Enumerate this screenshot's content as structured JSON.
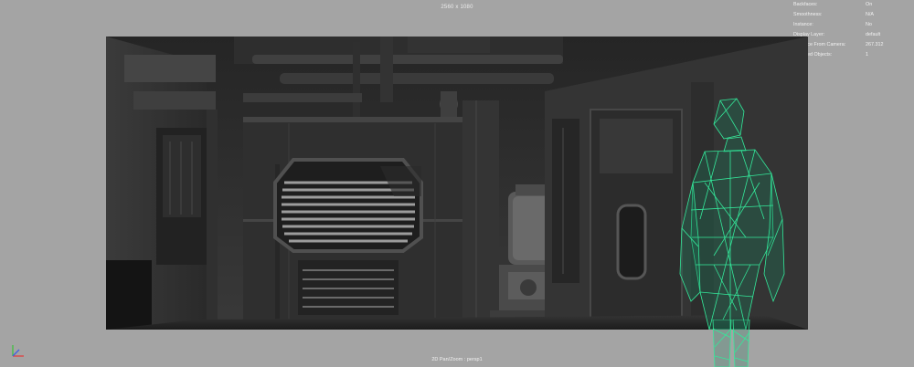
{
  "viewport": {
    "resolution_label": "2560 x 1080",
    "camera_label": "2D Pan/Zoom : persp1"
  },
  "hud": [
    {
      "key": "Backfaces:",
      "value": "On"
    },
    {
      "key": "Smoothness:",
      "value": "N/A"
    },
    {
      "key": "Instance:",
      "value": "No"
    },
    {
      "key": "Display Layer:",
      "value": "default"
    },
    {
      "key": "Distance From Camera:",
      "value": "267.312"
    },
    {
      "key": "Selected Objects:",
      "value": "1"
    }
  ],
  "scene": {
    "icons": [
      "axis-gizmo-icon"
    ],
    "colors": {
      "viewport_bg": "#a4a4a4",
      "render_bg": "#2b2b2b",
      "wireframe": "#34e89a",
      "hud_text": "#f2f2f2"
    }
  }
}
